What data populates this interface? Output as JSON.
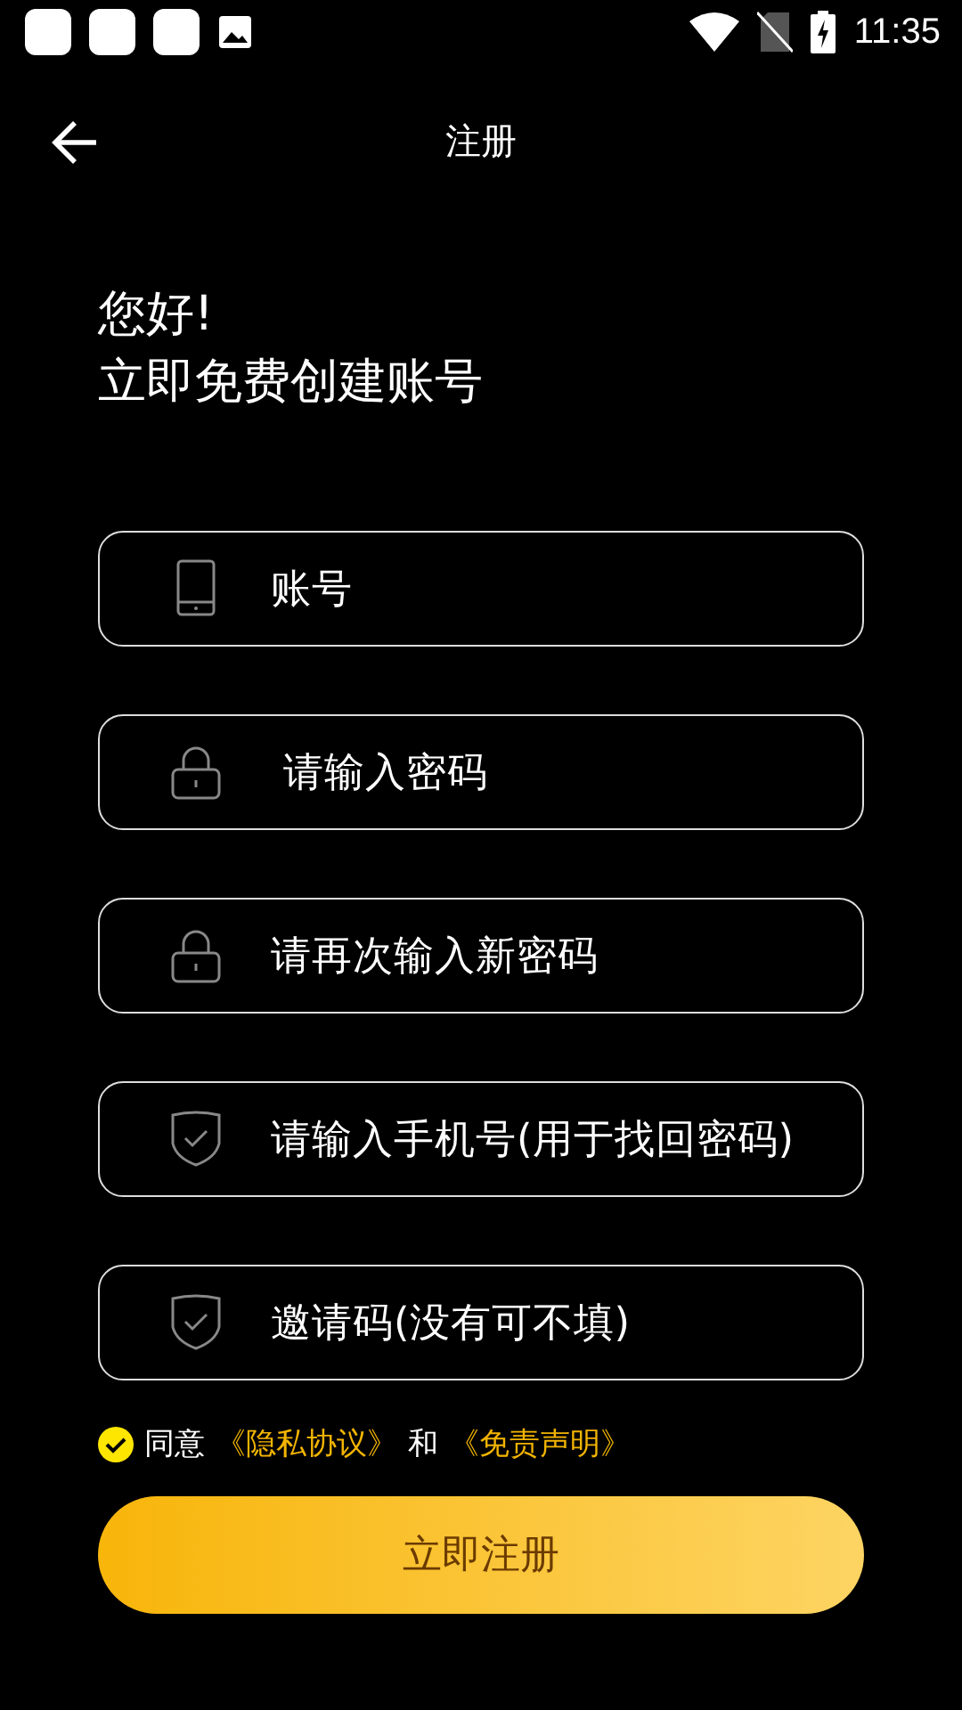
{
  "status_bar": {
    "time": "11:35"
  },
  "header": {
    "title": "注册"
  },
  "greeting": {
    "line_1": "您好!",
    "line_2": "立即免费创建账号"
  },
  "fields": [
    {
      "kind": "phone",
      "placeholder": "账号"
    },
    {
      "kind": "lock",
      "placeholder": " 请输入密码"
    },
    {
      "kind": "lock",
      "placeholder": "请再次输入新密码"
    },
    {
      "kind": "shield",
      "placeholder": "请输入手机号(用于找回密码)"
    },
    {
      "kind": "shield",
      "placeholder": "邀请码(没有可不填)"
    }
  ],
  "agreement": {
    "checked": true,
    "prefix": "同意",
    "link_1": "《隐私协议》",
    "joiner": "和",
    "link_2": "《免责声明》"
  },
  "submit_button": "立即注册"
}
